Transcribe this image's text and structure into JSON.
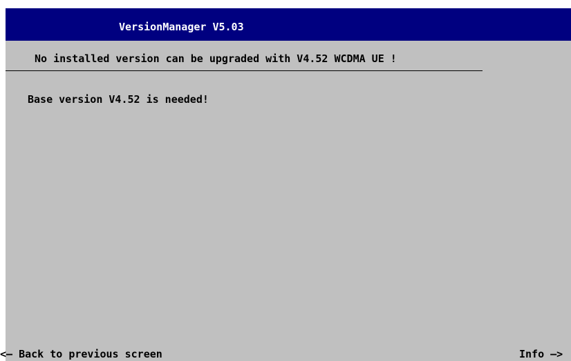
{
  "window": {
    "title": "VersionManager V5.03"
  },
  "main": {
    "message": "No installed version can be upgraded with V4.52 WCDMA UE !",
    "detail": "Base version V4.52 is needed!"
  },
  "footer": {
    "back_label": "<— Back to previous screen",
    "info_label": "Info —>"
  },
  "colors": {
    "titlebar": "#000080",
    "background": "#c0c0c0"
  }
}
